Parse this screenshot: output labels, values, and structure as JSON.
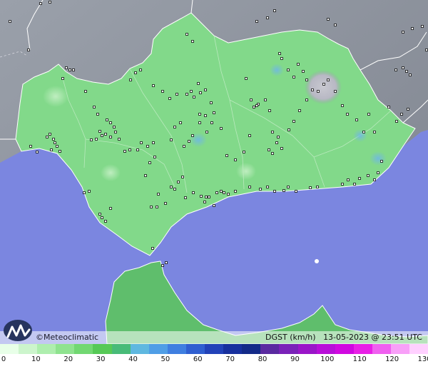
{
  "map": {
    "brand": "©Meteoclimatic",
    "caption_variable": "DGST (km/h)",
    "caption_timestamp": "13-05-2023 @ 23:51 UTC"
  },
  "legend": {
    "ticks": [
      "0",
      "10",
      "20",
      "30",
      "40",
      "50",
      "60",
      "70",
      "80",
      "90",
      "100",
      "110",
      "120",
      "130"
    ],
    "colors": [
      "#e8ffe8",
      "#ccf5cc",
      "#aeeeae",
      "#8fe38f",
      "#72d872",
      "#56c956",
      "#48bb78",
      "#5fb8e0",
      "#4f9ee6",
      "#3f7fe0",
      "#2f5fd0",
      "#2242b8",
      "#17309e",
      "#132a88",
      "#5a2aa0",
      "#7a22b8",
      "#9a16c8",
      "#b80ed8",
      "#d008e0",
      "#e820e6",
      "#f060f0",
      "#f8a0f8",
      "#ffd0ff"
    ],
    "accent_land": "#82d98a",
    "accent_sea": "#7b86e0",
    "accent_terrain": "#8a8f9a"
  },
  "stations": [
    [
      14,
      30
    ],
    [
      57,
      5
    ],
    [
      70,
      3
    ],
    [
      40,
      70
    ],
    [
      88,
      110
    ],
    [
      93,
      95
    ],
    [
      98,
      98
    ],
    [
      103,
      98
    ],
    [
      120,
      128
    ],
    [
      132,
      150
    ],
    [
      137,
      160
    ],
    [
      150,
      168
    ],
    [
      155,
      172
    ],
    [
      160,
      178
    ],
    [
      148,
      188
    ],
    [
      155,
      192
    ],
    [
      140,
      184
    ],
    [
      143,
      190
    ],
    [
      162,
      185
    ],
    [
      135,
      195
    ],
    [
      128,
      196
    ],
    [
      167,
      195
    ],
    [
      70,
      188
    ],
    [
      66,
      192
    ],
    [
      75,
      195
    ],
    [
      77,
      200
    ],
    [
      72,
      210
    ],
    [
      80,
      205
    ],
    [
      84,
      212
    ],
    [
      52,
      213
    ],
    [
      43,
      205
    ],
    [
      118,
      270
    ],
    [
      125,
      268
    ],
    [
      140,
      300
    ],
    [
      143,
      305
    ],
    [
      148,
      310
    ],
    [
      155,
      292
    ],
    [
      175,
      212
    ],
    [
      182,
      210
    ],
    [
      193,
      210
    ],
    [
      198,
      200
    ],
    [
      207,
      205
    ],
    [
      215,
      200
    ],
    [
      217,
      220
    ],
    [
      210,
      228
    ],
    [
      204,
      246
    ],
    [
      212,
      290
    ],
    [
      220,
      290
    ],
    [
      222,
      272
    ],
    [
      232,
      285
    ],
    [
      240,
      262
    ],
    [
      245,
      265
    ],
    [
      250,
      255
    ],
    [
      256,
      248
    ],
    [
      260,
      277
    ],
    [
      271,
      270
    ],
    [
      282,
      275
    ],
    [
      289,
      276
    ],
    [
      293,
      276
    ],
    [
      287,
      283
    ],
    [
      300,
      288
    ],
    [
      304,
      270
    ],
    [
      310,
      268
    ],
    [
      314,
      270
    ],
    [
      320,
      272
    ],
    [
      330,
      268
    ],
    [
      350,
      262
    ],
    [
      365,
      265
    ],
    [
      375,
      262
    ],
    [
      385,
      268
    ],
    [
      398,
      267
    ],
    [
      404,
      262
    ],
    [
      415,
      268
    ],
    [
      435,
      263
    ],
    [
      445,
      262
    ],
    [
      480,
      258
    ],
    [
      488,
      252
    ],
    [
      497,
      258
    ],
    [
      504,
      250
    ],
    [
      516,
      246
    ],
    [
      525,
      252
    ],
    [
      530,
      242
    ],
    [
      535,
      226
    ],
    [
      278,
      117
    ],
    [
      268,
      128
    ],
    [
      262,
      132
    ],
    [
      272,
      136
    ],
    [
      281,
      130
    ],
    [
      288,
      126
    ],
    [
      296,
      144
    ],
    [
      300,
      158
    ],
    [
      288,
      162
    ],
    [
      280,
      160
    ],
    [
      245,
      178
    ],
    [
      253,
      172
    ],
    [
      240,
      196
    ],
    [
      265,
      198
    ],
    [
      258,
      205
    ],
    [
      270,
      190
    ],
    [
      280,
      172
    ],
    [
      290,
      185
    ],
    [
      297,
      172
    ],
    [
      310,
      180
    ],
    [
      318,
      218
    ],
    [
      330,
      224
    ],
    [
      342,
      213
    ],
    [
      350,
      190
    ],
    [
      356,
      150
    ],
    [
      362,
      146
    ],
    [
      372,
      140
    ],
    [
      378,
      155
    ],
    [
      382,
      185
    ],
    [
      390,
      192
    ],
    [
      388,
      200
    ],
    [
      395,
      208
    ],
    [
      382,
      215
    ],
    [
      377,
      210
    ],
    [
      405,
      182
    ],
    [
      412,
      170
    ],
    [
      420,
      155
    ],
    [
      430,
      140
    ],
    [
      438,
      126
    ],
    [
      446,
      128
    ],
    [
      454,
      118
    ],
    [
      460,
      112
    ],
    [
      470,
      128
    ],
    [
      480,
      148
    ],
    [
      487,
      160
    ],
    [
      500,
      168
    ],
    [
      510,
      185
    ],
    [
      517,
      160
    ],
    [
      525,
      185
    ],
    [
      545,
      150
    ],
    [
      556,
      170
    ],
    [
      563,
      160
    ],
    [
      572,
      153
    ],
    [
      570,
      100
    ],
    [
      565,
      95
    ],
    [
      575,
      105
    ],
    [
      555,
      98
    ],
    [
      578,
      40
    ],
    [
      565,
      45
    ],
    [
      592,
      37
    ],
    [
      598,
      70
    ],
    [
      404,
      98
    ],
    [
      412,
      108
    ],
    [
      418,
      90
    ],
    [
      425,
      100
    ],
    [
      430,
      112
    ],
    [
      392,
      75
    ],
    [
      395,
      82
    ],
    [
      345,
      110
    ],
    [
      352,
      140
    ],
    [
      360,
      148
    ],
    [
      183,
      112
    ],
    [
      190,
      102
    ],
    [
      197,
      98
    ],
    [
      215,
      120
    ],
    [
      228,
      128
    ],
    [
      238,
      138
    ],
    [
      248,
      132
    ],
    [
      262,
      48
    ],
    [
      270,
      58
    ],
    [
      214,
      348
    ],
    [
      228,
      372
    ],
    [
      233,
      368
    ],
    [
      460,
      27
    ],
    [
      470,
      35
    ],
    [
      360,
      30
    ],
    [
      385,
      15
    ],
    [
      375,
      25
    ]
  ]
}
